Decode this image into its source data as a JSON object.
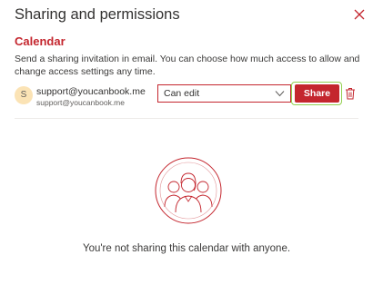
{
  "dialog": {
    "title": "Sharing and permissions",
    "close_icon": "close-icon"
  },
  "calendar": {
    "name": "Calendar",
    "description": "Send a sharing invitation in email. You can choose how much access to allow and change access settings any time."
  },
  "invite": {
    "avatar_initial": "S",
    "email": "support@youcanbook.me",
    "email_sub": "support@youcanbook.me",
    "permission": "Can edit",
    "share_label": "Share",
    "delete_icon": "trash-icon"
  },
  "empty_state": {
    "illustration": "people-group-icon",
    "message": "You're not sharing this calendar with anyone."
  },
  "colors": {
    "accent": "#c4262e",
    "highlight": "#92d050",
    "avatar_bg": "#fbe3b5"
  }
}
